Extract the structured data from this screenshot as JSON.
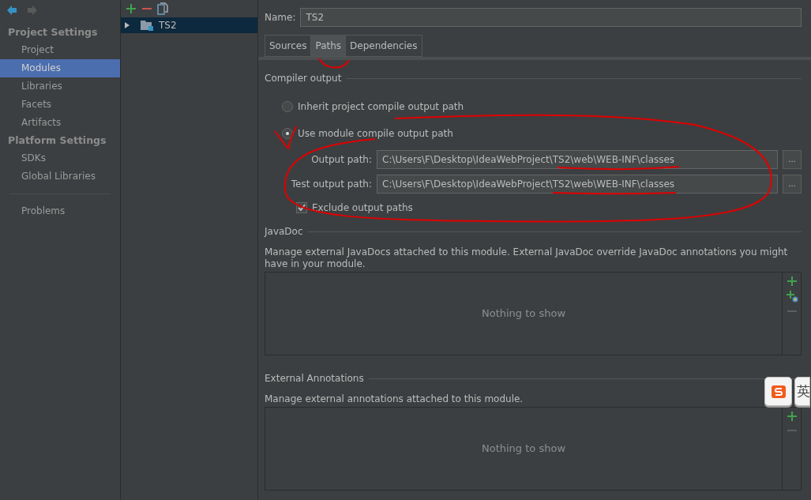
{
  "nav": {
    "back_enabled": true,
    "forward_enabled": false
  },
  "sidebar": {
    "sections": [
      {
        "title": "Project Settings",
        "items": [
          {
            "label": "Project",
            "selected": false
          },
          {
            "label": "Modules",
            "selected": true
          },
          {
            "label": "Libraries",
            "selected": false
          },
          {
            "label": "Facets",
            "selected": false
          },
          {
            "label": "Artifacts",
            "selected": false
          }
        ]
      },
      {
        "title": "Platform Settings",
        "items": [
          {
            "label": "SDKs",
            "selected": false
          },
          {
            "label": "Global Libraries",
            "selected": false
          }
        ]
      }
    ],
    "footer_items": [
      {
        "label": "Problems",
        "selected": false
      }
    ]
  },
  "module_tree": {
    "items": [
      {
        "label": "TS2",
        "expanded": false,
        "selected": true
      }
    ]
  },
  "name_field": {
    "label": "Name:",
    "value": "TS2"
  },
  "tabs": [
    {
      "label": "Sources",
      "selected": false
    },
    {
      "label": "Paths",
      "selected": true
    },
    {
      "label": "Dependencies",
      "selected": false
    }
  ],
  "compiler_output": {
    "title": "Compiler output",
    "options": [
      {
        "label": "Inherit project compile output path",
        "selected": false
      },
      {
        "label": "Use module compile output path",
        "selected": true
      }
    ],
    "paths": [
      {
        "label": "Output path:",
        "value": "C:\\Users\\F\\Desktop\\IdeaWebProject\\TS2\\web\\WEB-INF\\classes",
        "browse": "..."
      },
      {
        "label": "Test output path:",
        "value": "C:\\Users\\F\\Desktop\\IdeaWebProject\\TS2\\web\\WEB-INF\\classes",
        "browse": "..."
      }
    ],
    "exclude": {
      "label": "Exclude output paths",
      "checked": true
    }
  },
  "javadoc": {
    "title": "JavaDoc",
    "description": "Manage external JavaDocs attached to this module. External JavaDoc override JavaDoc annotations you might have in your module.",
    "empty_text": "Nothing to show",
    "tools": [
      {
        "kind": "add",
        "disabled": false
      },
      {
        "kind": "add-web",
        "disabled": false
      },
      {
        "kind": "remove",
        "disabled": true
      }
    ]
  },
  "external_annotations": {
    "title": "External Annotations",
    "description": "Manage external annotations attached to this module.",
    "empty_text": "Nothing to show",
    "tools": [
      {
        "kind": "add",
        "disabled": false
      },
      {
        "kind": "remove",
        "disabled": true
      }
    ]
  },
  "ime_toolbar": {
    "mode": "英"
  }
}
